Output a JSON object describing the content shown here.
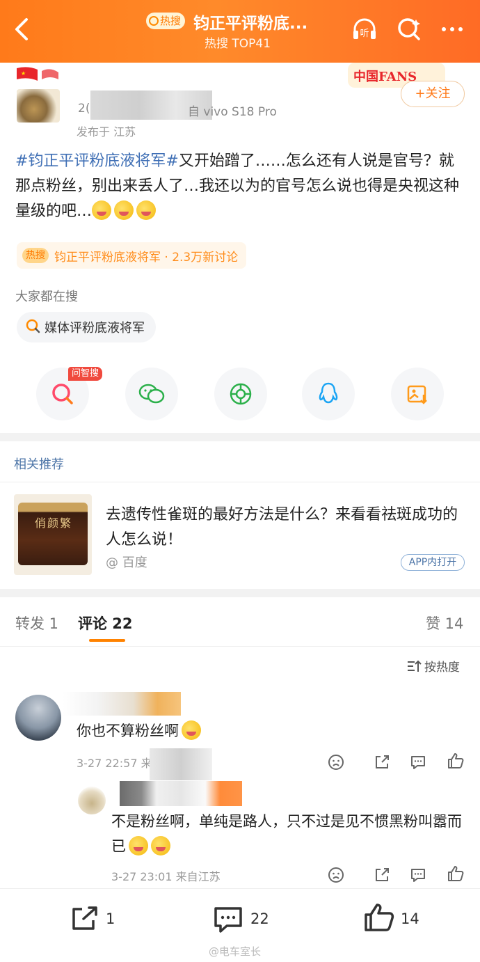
{
  "header": {
    "hot_badge": "热搜",
    "title": "钧正平评粉底...",
    "subtitle": "热搜 TOP41",
    "listen_label": "听"
  },
  "post": {
    "device_prefix": "2(",
    "device": "自 vivo S18 Pro",
    "from": "发布于 江苏",
    "follow_label": "+关注",
    "fans_badge_text": "中国FANS",
    "text_tag": "#钧正平评粉底液将军#",
    "text_body": "又开始蹭了……怎么还有人说是官号？就那点粉丝，别出来丢人了…我还以为的官号怎么说也得是央视这种量级的吧…",
    "topic_hot": "热搜",
    "topic_text": "钧正平评粉底液将军 · 2.3万新讨论",
    "search_label": "大家都在搜",
    "search_item": "媒体评粉底液将军",
    "wenzhisou_badge": "问智搜"
  },
  "recommend": {
    "label": "相关推荐",
    "title": "去遗传性雀斑的最好方法是什么？来看看祛斑成功的人怎么说！",
    "source": "@ 百度",
    "app_button": "APP内打开",
    "image_text": "俏颜繁"
  },
  "tabs": {
    "repost": "转发 1",
    "comment": "评论 22",
    "like": "赞 14",
    "sort": "按热度"
  },
  "comments": [
    {
      "text": "你也不算粉丝啊",
      "time": "3-27 22:57  来自广"
    },
    {
      "text": "不是粉丝啊，单纯是路人，只不过是见不惯黑粉叫嚣而已",
      "time": "3-27 23:01  来自江苏"
    }
  ],
  "bottom_bar": {
    "repost_count": "1",
    "comment_count": "22",
    "like_count": "14"
  },
  "watermark": "@电车室长",
  "colors": {
    "accent": "#ff7a1a",
    "link": "#3f6fb5",
    "hot_badge": "#f04a3e"
  }
}
